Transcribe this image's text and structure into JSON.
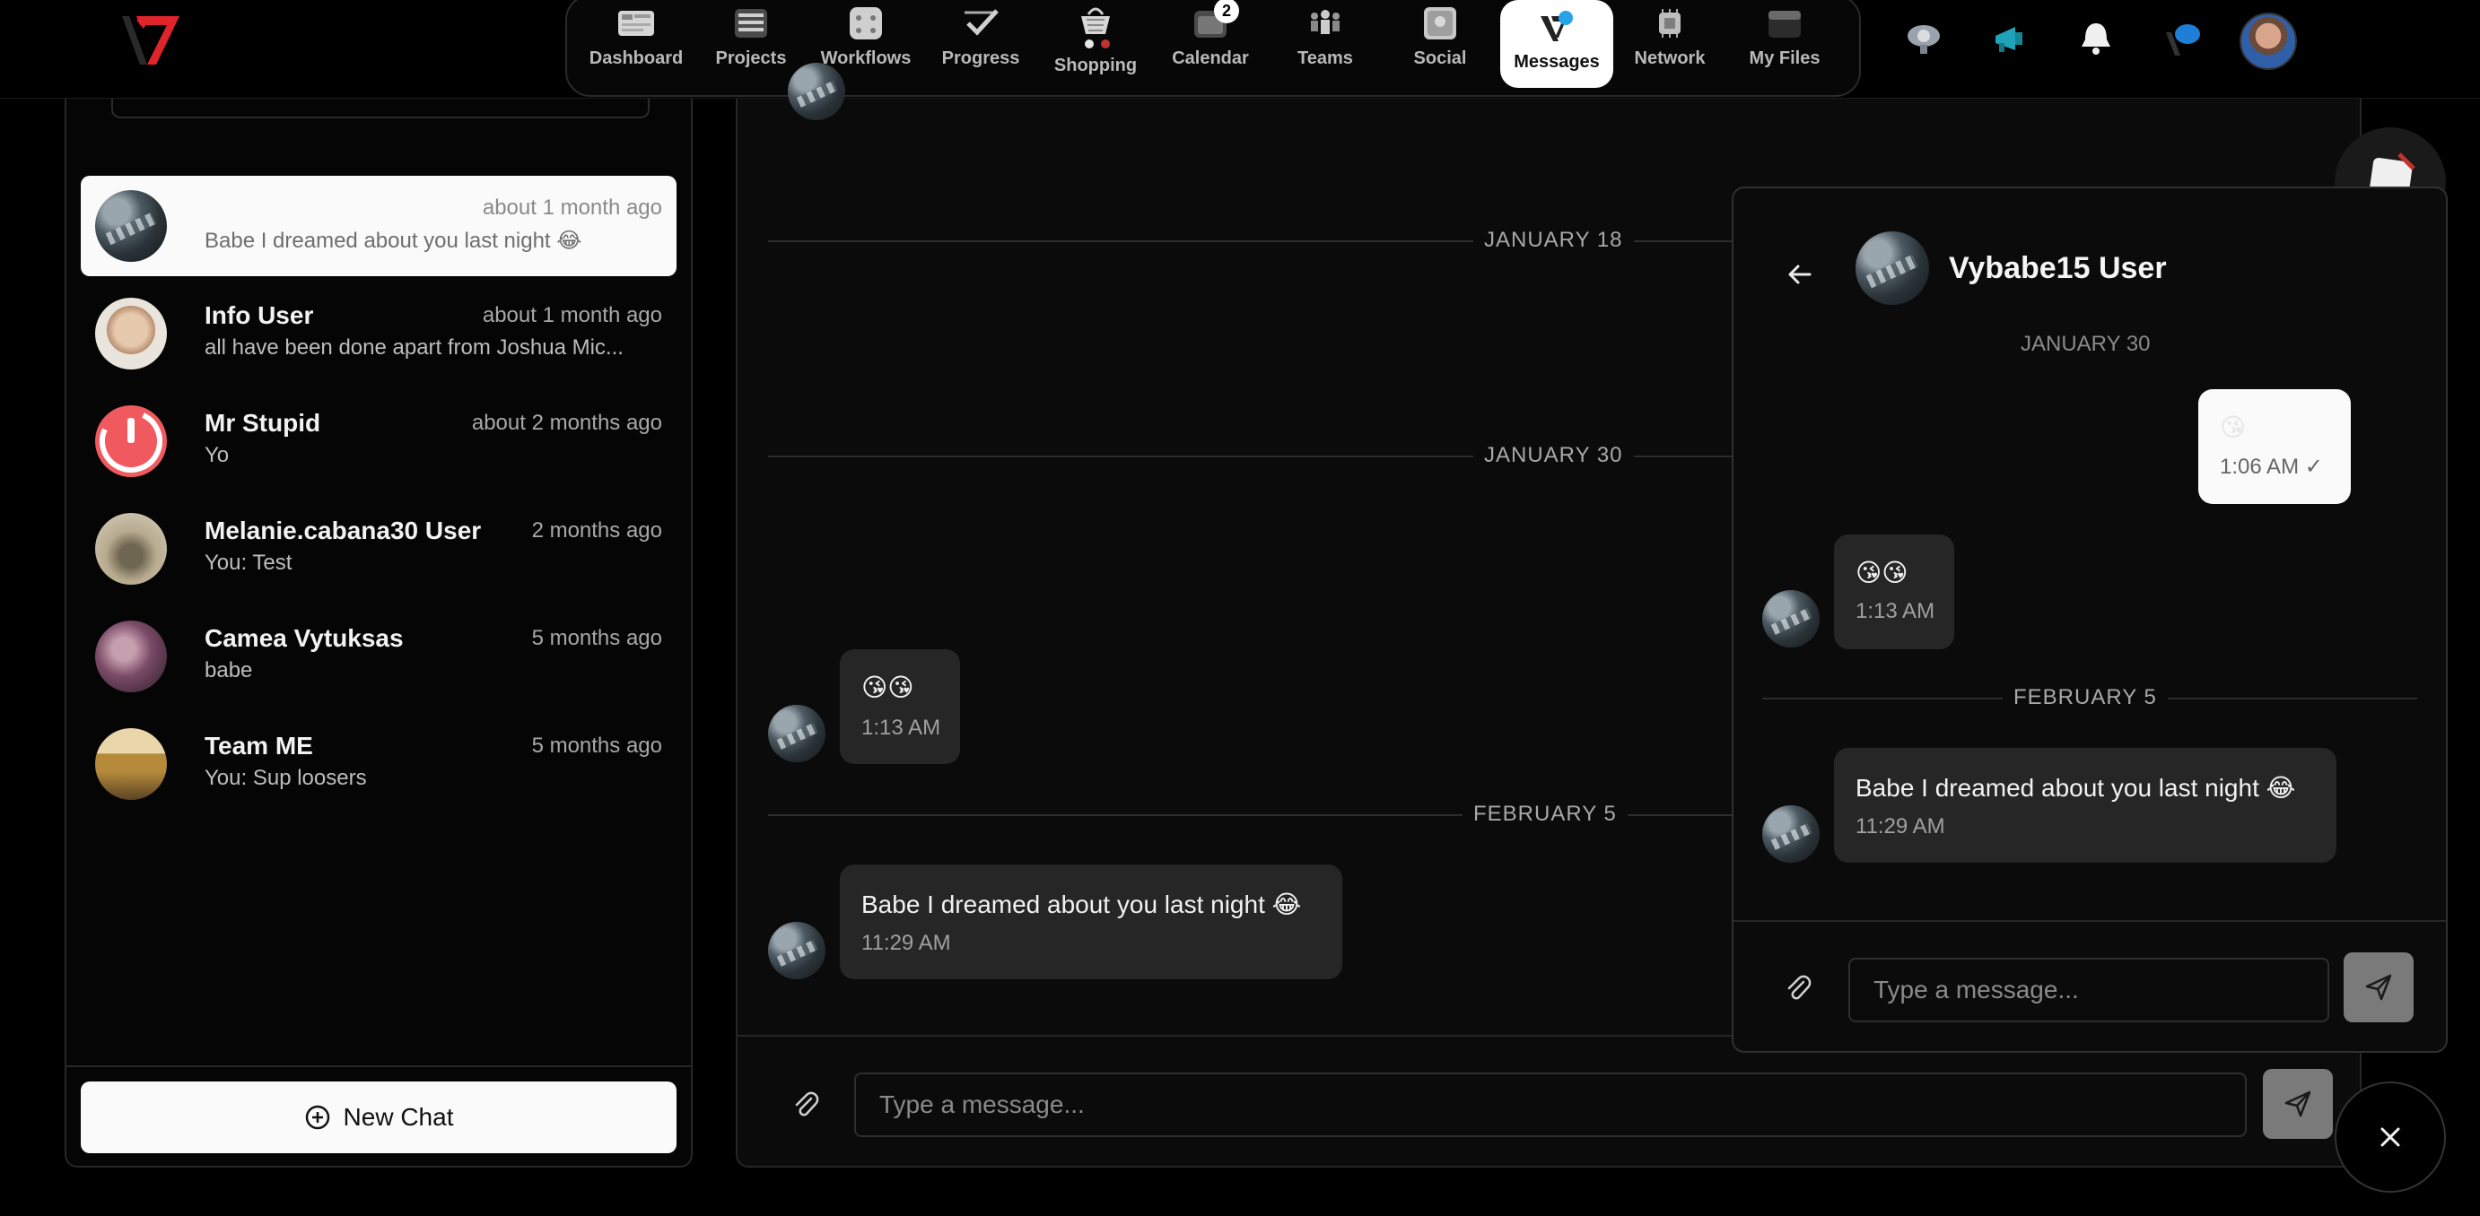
{
  "nav": {
    "items": [
      {
        "label": "Dashboard"
      },
      {
        "label": "Projects"
      },
      {
        "label": "Workflows"
      },
      {
        "label": "Progress"
      },
      {
        "label": "Shopping"
      },
      {
        "label": "Calendar",
        "badge": "2"
      },
      {
        "label": "Teams"
      },
      {
        "label": "Social"
      },
      {
        "label": "Messages",
        "active": true
      },
      {
        "label": "Network"
      },
      {
        "label": "My Files"
      }
    ],
    "right_icons": [
      "support-icon",
      "megaphone-icon",
      "bell-icon",
      "chat-bubble-icon"
    ]
  },
  "conversations": [
    {
      "name": "",
      "time": "about 1 month ago",
      "preview": "Babe I dreamed about you last night 😂",
      "active": true
    },
    {
      "name": "Info User",
      "time": "about 1 month ago",
      "preview": "all have been done apart from Joshua Mic..."
    },
    {
      "name": "Mr Stupid",
      "time": "about 2 months ago",
      "preview": "Yo"
    },
    {
      "name": "Melanie.cabana30 User",
      "time": "2 months ago",
      "preview": "You: Test"
    },
    {
      "name": "Camea Vytuksas",
      "time": "5 months ago",
      "preview": "babe"
    },
    {
      "name": "Team ME",
      "time": "5 months ago",
      "preview": "You: Sup loosers"
    }
  ],
  "new_chat_label": "New Chat",
  "main_chat": {
    "date_separators": [
      "JANUARY 18",
      "JANUARY 30",
      "FEBRUARY 5"
    ],
    "messages": [
      {
        "text": "😘😘",
        "time": "1:13 AM"
      },
      {
        "text": "Babe I dreamed about you last night 😂",
        "time": "11:29 AM"
      }
    ],
    "input_placeholder": "Type a message..."
  },
  "popup": {
    "contact_name": "Vybabe15 User",
    "cut_date": "JANUARY 30",
    "outgoing": {
      "text": "😘",
      "time": "1:06 AM ✓"
    },
    "incoming_1": {
      "text": "😘😘",
      "time": "1:13 AM"
    },
    "separator": "FEBRUARY 5",
    "incoming_2": {
      "text": "Babe I dreamed about you last night 😂",
      "time": "11:29 AM"
    },
    "input_placeholder": "Type a message..."
  },
  "colors": {
    "accent": "#ffffff",
    "panel": "#0b0b0b",
    "bubble": "#262626",
    "send": "#7a7a7a",
    "logo_red": "#e0242b"
  }
}
